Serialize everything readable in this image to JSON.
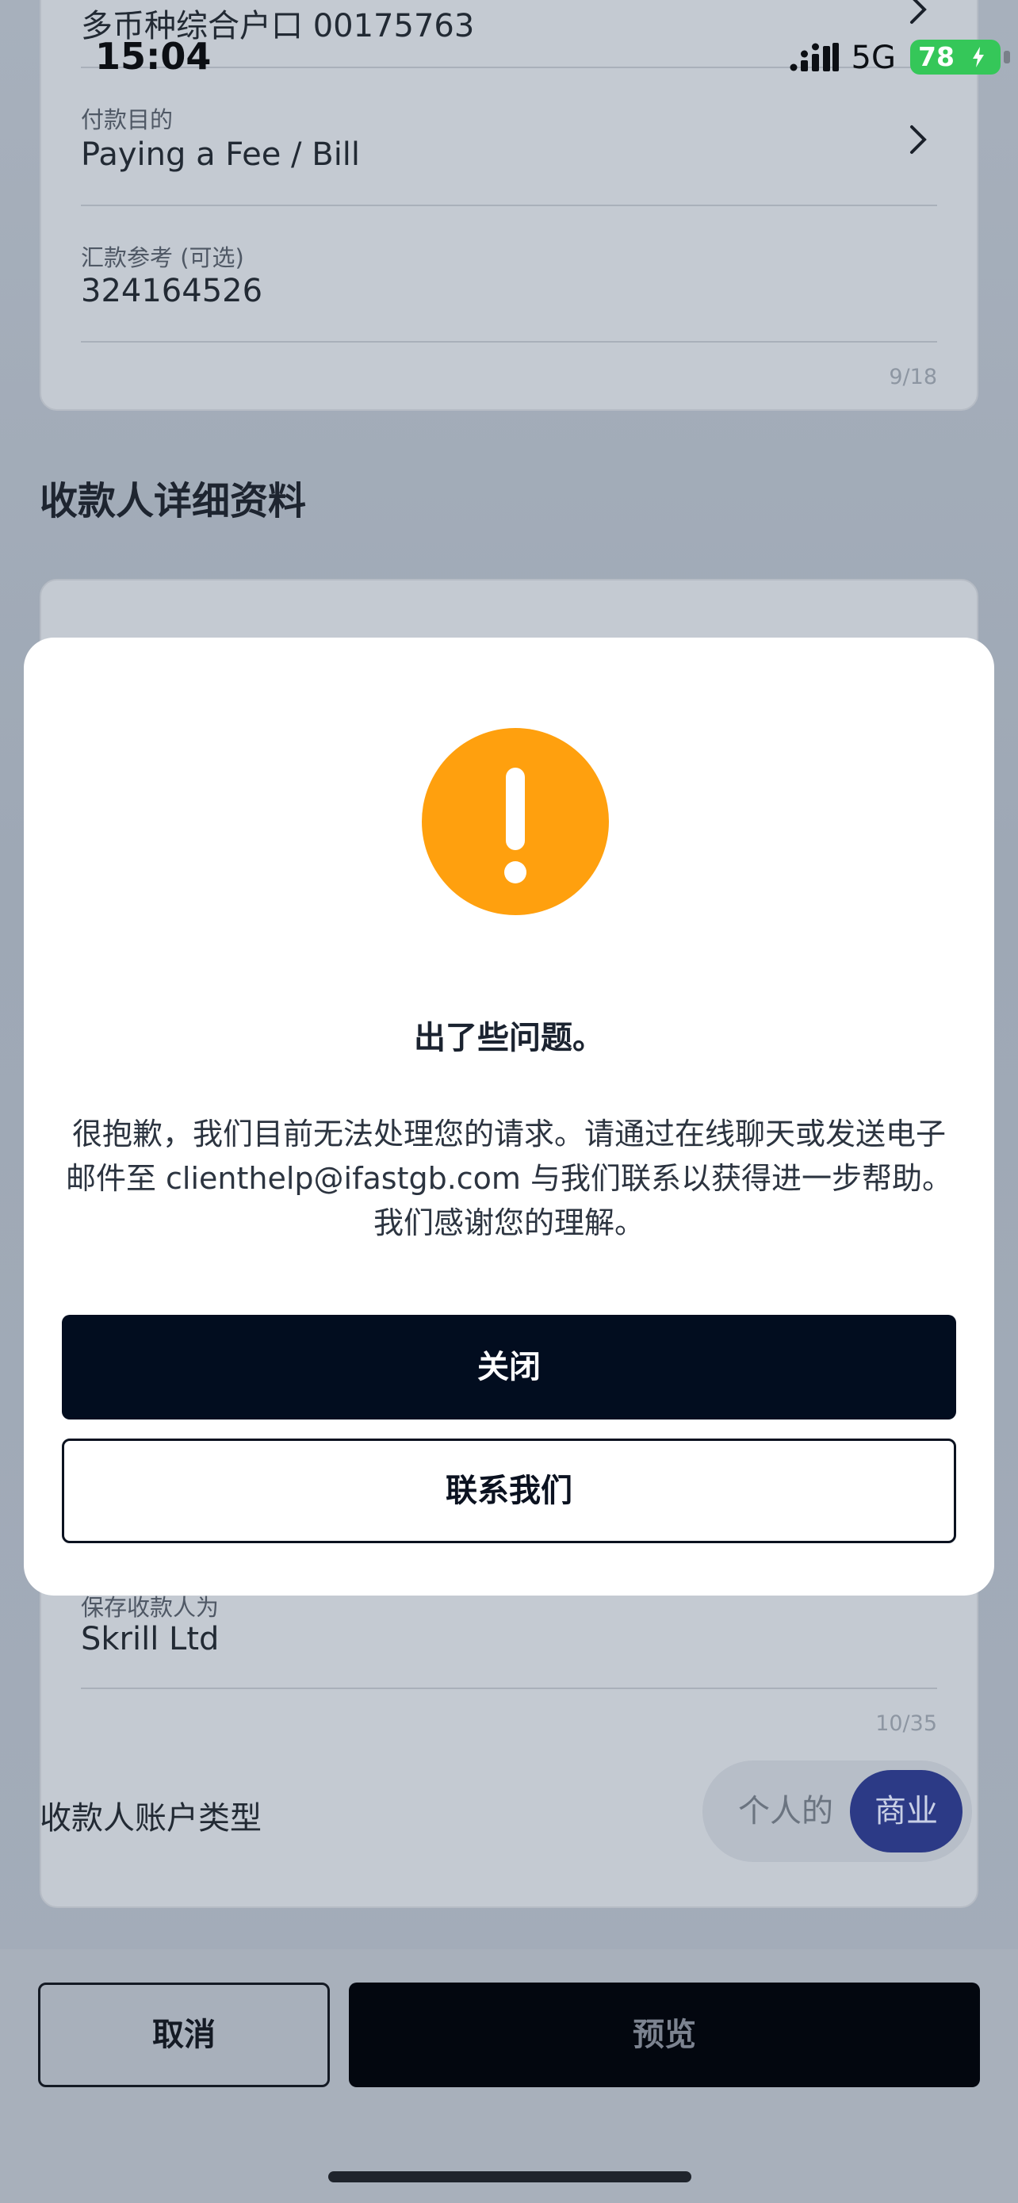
{
  "status_bar": {
    "time": "15:04",
    "network": "5G",
    "battery": "78"
  },
  "top_card": {
    "account_value": "多币种综合户口 00175763",
    "purpose_label": "付款目的",
    "purpose_value": "Paying a Fee / Bill",
    "reference_label": "汇款参考 (可选)",
    "reference_value": "324164526",
    "reference_counter": "9/18"
  },
  "beneficiary": {
    "section_title": "收款人详细资料",
    "saved_name_label": "保存收款人为",
    "saved_name_value": "Skrill Ltd",
    "saved_name_counter": "10/35",
    "account_type_label": "收款人账户类型",
    "account_type_personal": "个人的",
    "account_type_business": "商业",
    "account_type_selected": "商业"
  },
  "footer": {
    "cancel_label": "取消",
    "preview_label": "预览"
  },
  "modal": {
    "icon": "exclamation-icon",
    "title": "出了些问题。",
    "message": "很抱歉，我们目前无法处理您的请求。请通过在线聊天或发送电子邮件至 clienthelp@ifastgb.com 与我们联系以获得进一步帮助。我们感谢您的理解。",
    "close_label": "关闭",
    "contact_label": "联系我们"
  },
  "colors": {
    "alert": "#ffa00e",
    "primary_button": "#020d1f",
    "battery": "#35c759",
    "toggle_selected": "#2c3a86"
  }
}
